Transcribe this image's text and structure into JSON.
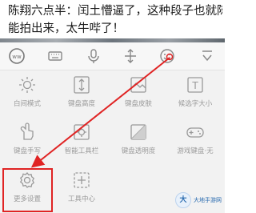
{
  "article": {
    "line1": "陈翔六点半：闰土懵逼了，这种段子也就陈翔",
    "line2": "能拍出来，太牛哔了！"
  },
  "toolbar": {
    "icons": [
      "logo-icon",
      "keyboard-icon",
      "microphone-icon",
      "move-cursor-icon",
      "emoji-icon",
      "collapse-icon"
    ]
  },
  "grid": {
    "items": [
      {
        "label": "白间模式",
        "icon": "sun-icon"
      },
      {
        "label": "键盘高度",
        "icon": "height-icon"
      },
      {
        "label": "键盘皮肤",
        "icon": "skin-icon"
      },
      {
        "label": "候选字大小",
        "icon": "font-size-icon"
      },
      {
        "label": "键盘手写",
        "icon": "handwrite-icon"
      },
      {
        "label": "智能工具栏",
        "icon": "toolbar-icon"
      },
      {
        "label": "键盘透明度",
        "icon": "opacity-icon"
      },
      {
        "label": "游戏键盘·无",
        "icon": "game-icon"
      },
      {
        "label": "更多设置",
        "icon": "gear-icon"
      },
      {
        "label": "工具中心",
        "icon": "tool-center-icon"
      }
    ]
  },
  "watermark": {
    "logo": "大",
    "line1": "大地手游网",
    "line2": ""
  },
  "colors": {
    "annotation": "#e02424",
    "icon": "#9a9a9a"
  }
}
